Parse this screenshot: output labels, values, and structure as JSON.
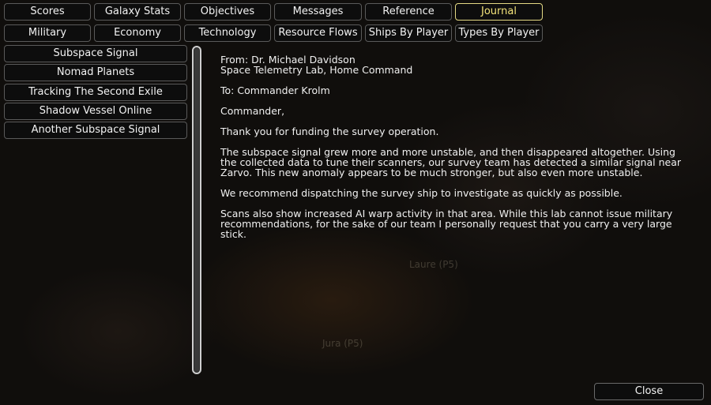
{
  "tabs_row1": [
    {
      "label": "Scores",
      "active": false
    },
    {
      "label": "Galaxy Stats",
      "active": false
    },
    {
      "label": "Objectives",
      "active": false
    },
    {
      "label": "Messages",
      "active": false
    },
    {
      "label": "Reference",
      "active": false
    },
    {
      "label": "Journal",
      "active": true
    }
  ],
  "tabs_row2": [
    {
      "label": "Military"
    },
    {
      "label": "Economy"
    },
    {
      "label": "Technology"
    },
    {
      "label": "Resource Flows"
    },
    {
      "label": "Ships By Player"
    },
    {
      "label": "Types By Player"
    }
  ],
  "journal_entries": [
    {
      "label": "Subspace Signal"
    },
    {
      "label": "Nomad Planets"
    },
    {
      "label": "Tracking The Second Exile"
    },
    {
      "label": "Shadow Vessel Online"
    },
    {
      "label": "Another Subspace Signal"
    }
  ],
  "message": {
    "from_line1": "From: Dr. Michael Davidson",
    "from_line2": "Space Telemetry Lab, Home Command",
    "to": "To: Commander Krolm",
    "greeting": "Commander,",
    "p1": "Thank you for funding the survey operation.",
    "p2": "The subspace signal grew more and more unstable, and then disappeared altogether.  Using the collected data to tune their scanners, our survey team has detected a similar signal near Zarvo. This new anomaly appears to be much stronger, but also even more unstable.",
    "p3": "We recommend dispatching the survey ship to investigate as quickly as possible.",
    "p4": "Scans also show increased AI warp activity in that area.  While this lab cannot issue military recommendations, for the sake of our team I personally request that you carry a very large stick."
  },
  "map_labels": {
    "planet1": "Laure (P5)",
    "planet2": "Jura (P5)"
  },
  "close_label": "Close",
  "colors": {
    "active_tab_border": "#e3d884",
    "active_tab_text": "#f3e37a",
    "button_border": "#5a5a5a",
    "button_bg": "#0d0d0d"
  }
}
